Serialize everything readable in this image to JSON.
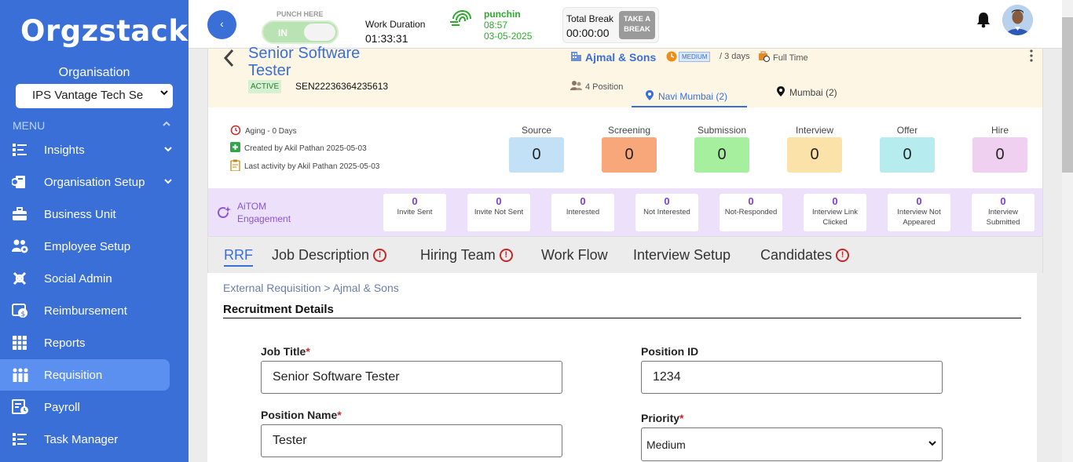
{
  "sidebar": {
    "logo": "Orgzstack",
    "org_label": "Organisation",
    "org_select": "IPS Vantage Tech Se",
    "menu_label": "MENU",
    "items": [
      {
        "label": "Insights",
        "icon": "list-icon",
        "has_caret": true
      },
      {
        "label": "Organisation Setup",
        "icon": "org-setup-icon",
        "has_caret": true
      },
      {
        "label": "Business Unit",
        "icon": "briefcase-icon",
        "has_caret": false
      },
      {
        "label": "Employee Setup",
        "icon": "people-gear-icon",
        "has_caret": false
      },
      {
        "label": "Social Admin",
        "icon": "social-icon",
        "has_caret": false
      },
      {
        "label": "Reimbursement",
        "icon": "reimburse-icon",
        "has_caret": false
      },
      {
        "label": "Reports",
        "icon": "grid-icon",
        "has_caret": false
      },
      {
        "label": "Requisition",
        "icon": "requisition-icon",
        "has_caret": false,
        "active": true
      },
      {
        "label": "Payroll",
        "icon": "payroll-icon",
        "has_caret": false
      },
      {
        "label": "Task Manager",
        "icon": "task-icon",
        "has_caret": false
      }
    ]
  },
  "topbar": {
    "back_icon": "‹",
    "punch_here": "PUNCH HERE",
    "toggle_text": "IN",
    "work_duration_label": "Work Duration",
    "work_duration_value": "01:33:31",
    "punchin_label": "punchin",
    "punchin_time": "08:57",
    "punchin_date": "03-05-2025",
    "total_break_label": "Total Break",
    "total_break_value": "00:00:00",
    "take_break_label": "TAKE A BREAK"
  },
  "requisition": {
    "title": "Senior Software Tester",
    "status": "ACTIVE",
    "code": "SEN22236364235613",
    "company": "Ajmal & Sons",
    "priority": "MEDIUM",
    "duration": "/ 3 days",
    "employment_type": "Full Time",
    "positions": "4 Position",
    "locations": [
      {
        "label": "Navi Mumbai (2)",
        "active": true
      },
      {
        "label": "Mumbai (2)",
        "active": false
      }
    ]
  },
  "meta": {
    "aging": "Aging - 0 Days",
    "created_by": "Created by Akil Pathan 2025-05-03",
    "last_activity": "Last activity by Akil Pathan 2025-05-03"
  },
  "stages": [
    {
      "label": "Source",
      "value": "0",
      "color": "#c3e1f6"
    },
    {
      "label": "Screening",
      "value": "0",
      "color": "#f7a77a"
    },
    {
      "label": "Submission",
      "value": "0",
      "color": "#a6ef9f"
    },
    {
      "label": "Interview",
      "value": "0",
      "color": "#fbe2a8"
    },
    {
      "label": "Offer",
      "value": "0",
      "color": "#b6ecee"
    },
    {
      "label": "Hire",
      "value": "0",
      "color": "#efd0f1"
    }
  ],
  "engagement": {
    "title_line1": "AiTOM",
    "title_line2": "Engagement",
    "cards": [
      {
        "value": "0",
        "label": "Invite Sent"
      },
      {
        "value": "0",
        "label": "Invite Not Sent"
      },
      {
        "value": "0",
        "label": "Interested"
      },
      {
        "value": "0",
        "label": "Not Interested"
      },
      {
        "value": "0",
        "label": "Not-Responded"
      },
      {
        "value": "0",
        "label": "Interview Link Clicked"
      },
      {
        "value": "0",
        "label": "Interview Not Appeared"
      },
      {
        "value": "0",
        "label": "Interview Submitted"
      }
    ]
  },
  "tabs": [
    {
      "label": "RRF",
      "active": true,
      "warn": false
    },
    {
      "label": "Job Description",
      "active": false,
      "warn": true
    },
    {
      "label": "Hiring Team",
      "active": false,
      "warn": true
    },
    {
      "label": "Work Flow",
      "active": false,
      "warn": false
    },
    {
      "label": "Interview Setup",
      "active": false,
      "warn": false
    },
    {
      "label": "Candidates",
      "active": false,
      "warn": true
    }
  ],
  "form": {
    "breadcrumb": "External Requisition > Ajmal & Sons",
    "section_title": "Recruitment Details",
    "job_title_label": "Job Title",
    "job_title_value": "Senior Software Tester",
    "position_id_label": "Position ID",
    "position_id_value": "1234",
    "position_name_label": "Position Name",
    "position_name_value": "Tester",
    "priority_label": "Priority",
    "priority_value": "Medium"
  }
}
